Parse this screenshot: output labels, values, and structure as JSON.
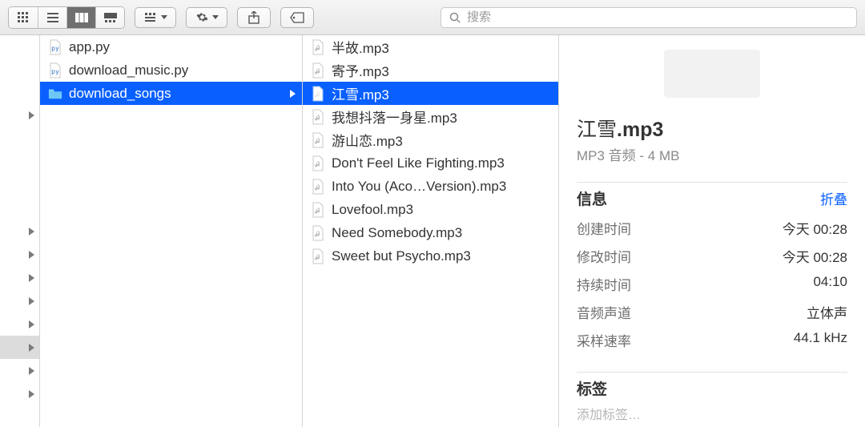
{
  "toolbar": {
    "search_placeholder": "搜索"
  },
  "column1": {
    "items": [
      {
        "name": "app.py",
        "type": "python"
      },
      {
        "name": "download_music.py",
        "type": "python"
      },
      {
        "name": "download_songs",
        "type": "folder",
        "selected": true,
        "has_children": true
      }
    ]
  },
  "column2": {
    "items": [
      {
        "name": "半故.mp3"
      },
      {
        "name": "寄予.mp3"
      },
      {
        "name": "江雪.mp3",
        "selected": true
      },
      {
        "name": "我想抖落一身星.mp3"
      },
      {
        "name": "游山恋.mp3"
      },
      {
        "name": "Don't Feel Like Fighting.mp3"
      },
      {
        "name": "Into You (Aco…Version).mp3"
      },
      {
        "name": "Lovefool.mp3"
      },
      {
        "name": "Need Somebody.mp3"
      },
      {
        "name": "Sweet but Psycho.mp3"
      }
    ]
  },
  "preview": {
    "title_base": "江雪",
    "title_ext": ".mp3",
    "subtitle": "MP3 音频 - 4 MB",
    "info_heading": "信息",
    "info_collapse": "折叠",
    "info_rows": [
      {
        "k": "创建时间",
        "v": "今天 00:28"
      },
      {
        "k": "修改时间",
        "v": "今天 00:28"
      },
      {
        "k": "持续时间",
        "v": "04:10"
      },
      {
        "k": "音频声道",
        "v": "立体声"
      },
      {
        "k": "采样速率",
        "v": "44.1 kHz"
      }
    ],
    "tags_heading": "标签",
    "tags_placeholder": "添加标签…"
  }
}
